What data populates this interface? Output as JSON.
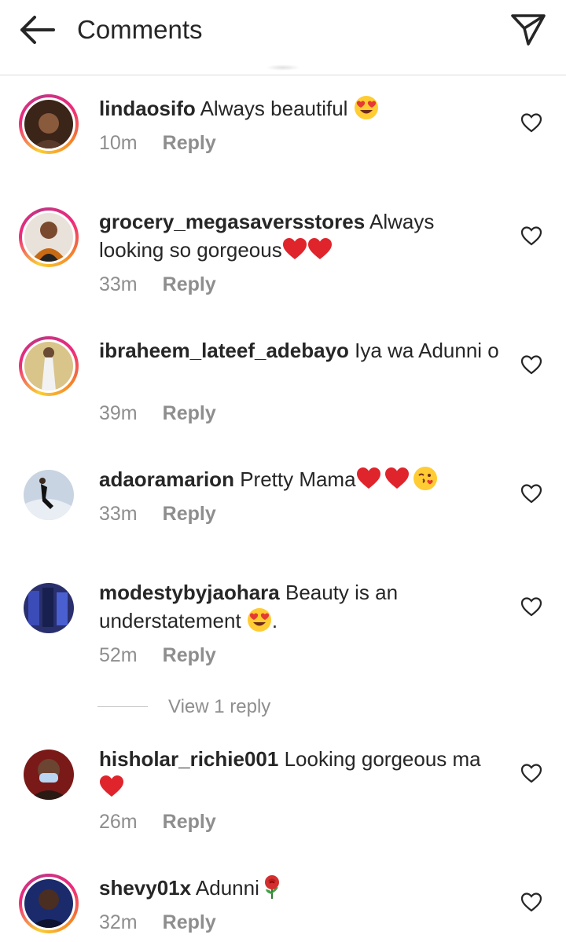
{
  "header": {
    "title": "Comments",
    "back_icon": "arrow-left-icon",
    "send_icon": "paper-plane-icon"
  },
  "colors": {
    "text": "#262626",
    "muted": "#8e8e8e",
    "divider": "#dbdbdb",
    "heart": "#e0242c",
    "story_ring": [
      "#f9ce34",
      "#ee2a7b",
      "#c13584",
      "#f58529"
    ]
  },
  "comments": [
    {
      "username": "lindaosifo",
      "text": "Always beautiful",
      "emojis": [
        "heart-eyes"
      ],
      "time": "10m",
      "reply_label": "Reply",
      "story_ring": true
    },
    {
      "username": "grocery_megasaversstores",
      "text": "Always looking so gorgeous",
      "emojis": [
        "red-heart",
        "red-heart"
      ],
      "time": "33m",
      "reply_label": "Reply",
      "story_ring": true
    },
    {
      "username": "ibraheem_lateef_adebayo",
      "text": "Iya wa Adunni o",
      "emojis": [],
      "time": "39m",
      "reply_label": "Reply",
      "story_ring": true
    },
    {
      "username": "adaoramarion",
      "text": "Pretty Mama",
      "emojis": [
        "red-heart",
        "red-heart",
        "kissing-wink"
      ],
      "time": "33m",
      "reply_label": "Reply",
      "story_ring": false
    },
    {
      "username": "modestybyjaohara",
      "text": "Beauty is an understatement",
      "text_suffix": ".",
      "emojis": [
        "heart-eyes"
      ],
      "time": "52m",
      "reply_label": "Reply",
      "story_ring": false,
      "view_replies": "View 1 reply"
    },
    {
      "username": "hisholar_richie001",
      "text": "Looking gorgeous ma",
      "emojis": [
        "red-heart"
      ],
      "time": "26m",
      "reply_label": "Reply",
      "story_ring": false
    },
    {
      "username": "shevy01x",
      "text": "Adunni",
      "emojis": [
        "rose"
      ],
      "time": "32m",
      "reply_label": "Reply",
      "story_ring": true
    }
  ]
}
